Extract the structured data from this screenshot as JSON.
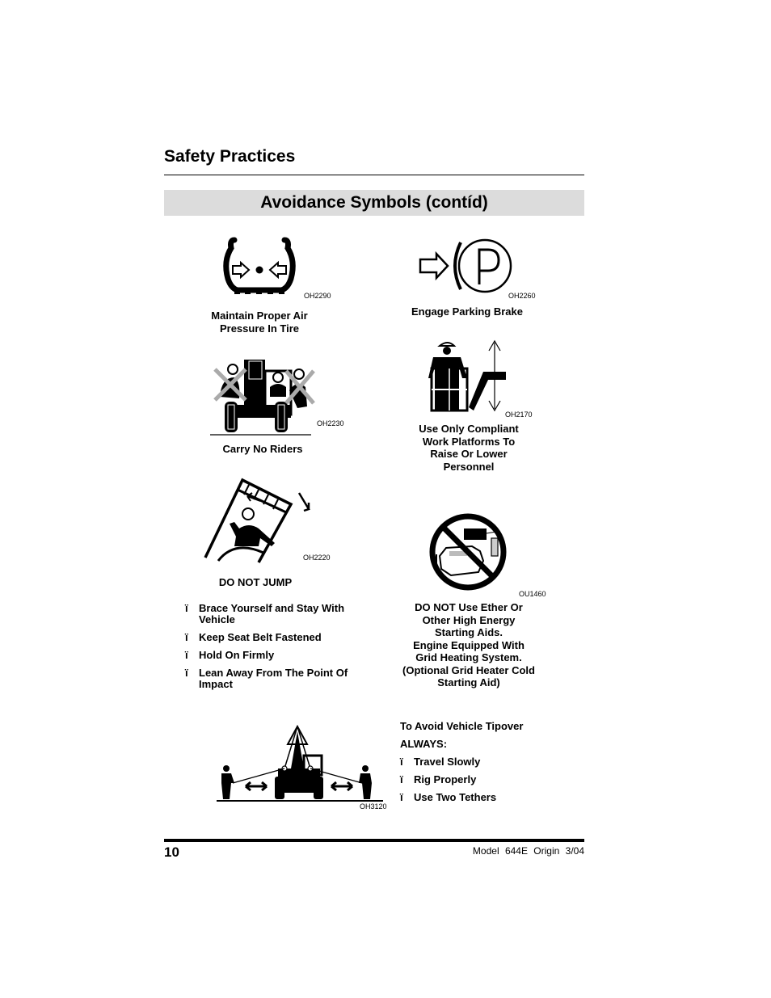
{
  "header": {
    "section_title": "Safety Practices",
    "banner_title": "Avoidance Symbols (contíd)"
  },
  "symbols": [
    {
      "id": "tire-pressure",
      "icon": "tire-pressure-icon",
      "code": "OH2290",
      "caption_lines": [
        "Maintain Proper Air",
        "Pressure In Tire"
      ]
    },
    {
      "id": "parking-brake",
      "icon": "parking-brake-icon",
      "code": "OH2260",
      "caption_lines": [
        "Engage Parking Brake"
      ]
    },
    {
      "id": "no-riders",
      "icon": "no-riders-icon",
      "code": "OH2230",
      "caption_lines": [
        "Carry No Riders"
      ]
    },
    {
      "id": "work-platform",
      "icon": "work-platform-icon",
      "code": "OH2170",
      "caption_lines": [
        "Use Only Compliant",
        "Work Platforms To",
        "Raise Or Lower",
        "Personnel"
      ]
    },
    {
      "id": "do-not-jump",
      "icon": "do-not-jump-icon",
      "code": "OH2220",
      "caption_lines": [
        "DO NOT JUMP"
      ],
      "bullets": [
        "Brace Yourself and Stay With Vehicle",
        "Keep Seat Belt Fastened",
        "Hold On Firmly",
        "Lean Away From The Point Of Impact"
      ]
    },
    {
      "id": "no-ether",
      "icon": "no-ether-icon",
      "code": "OU1460",
      "caption_lines": [
        "DO NOT Use Ether Or",
        "Other High Energy",
        "Starting Aids.",
        "Engine Equipped With",
        "Grid Heating System.",
        "(Optional Grid Heater Cold",
        "Starting Aid)"
      ]
    },
    {
      "id": "tipover",
      "icon": "tethered-load-icon",
      "code": "OH3120",
      "caption_lines": [
        "To Avoid Vehicle Tipover",
        "ALWAYS:"
      ],
      "bullets": [
        "Travel Slowly",
        "Rig Properly",
        "Use Two Tethers"
      ]
    }
  ],
  "bullet_mark": "ï",
  "footer": {
    "page_number": "10",
    "meta": "Model 644E  Origin 3/04"
  }
}
